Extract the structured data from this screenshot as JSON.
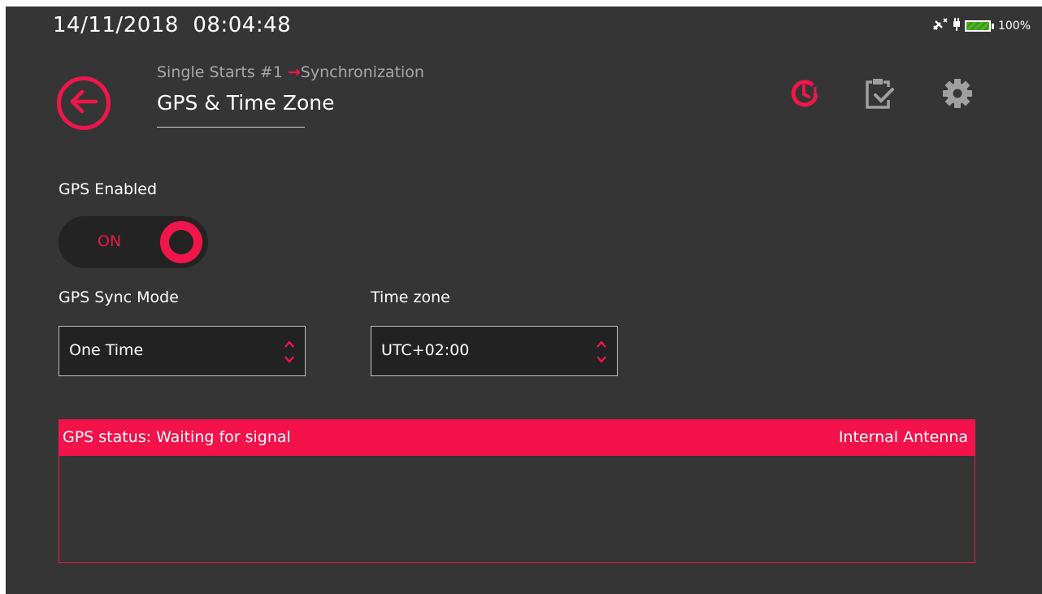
{
  "status_bar": {
    "datetime": "14/11/2018  08:04:48",
    "battery_percent": "100%",
    "battery_level": 1.0
  },
  "header": {
    "breadcrumb_parent": "Single Starts #1",
    "breadcrumb_current": "Synchronization",
    "title": "GPS & Time Zone"
  },
  "toolbar": {
    "icons": [
      "clock-sync-icon",
      "clipboard-check-icon",
      "gear-icon"
    ]
  },
  "gps_enabled": {
    "label": "GPS Enabled",
    "toggle_text": "ON"
  },
  "sync_mode": {
    "label": "GPS Sync Mode",
    "value": "One Time"
  },
  "time_zone": {
    "label": "Time zone",
    "value": "UTC+02:00"
  },
  "gps_panel": {
    "status": "GPS status: Waiting for signal",
    "antenna": "Internal Antenna"
  },
  "colors": {
    "accent": "#f0164a",
    "background": "#353535",
    "muted_icon": "#a0a0a0"
  }
}
